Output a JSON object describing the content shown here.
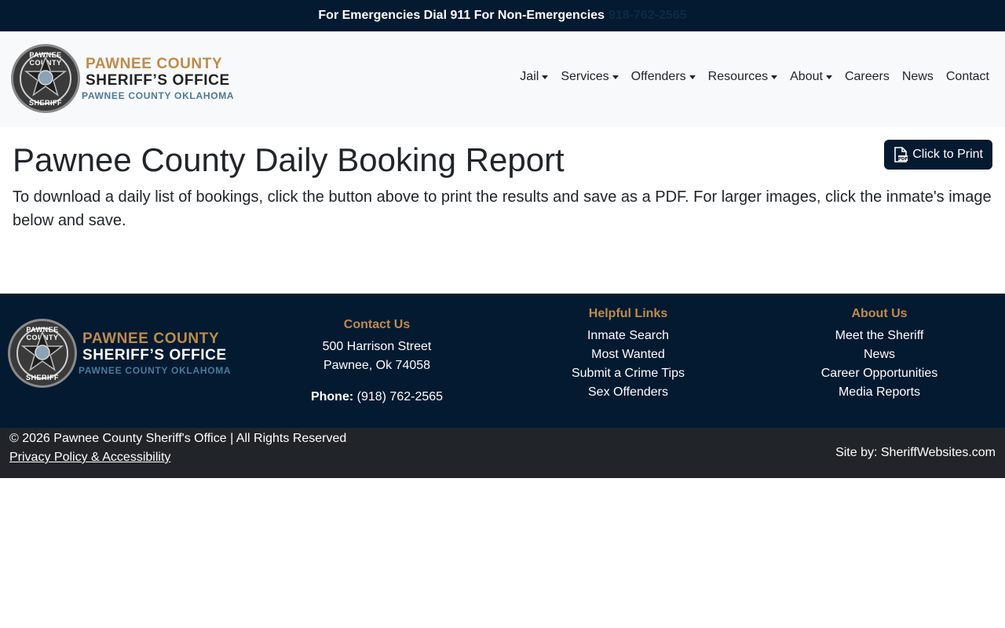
{
  "alert": {
    "text": "For Emergencies Dial 911 For Non-Emergencies",
    "phone": "918-762-2565"
  },
  "logo": {
    "line1": "PAWNEE COUNTY",
    "line2": "SHERIFF’S OFFICE",
    "line3": "PAWNEE COUNTY OKLAHOMA",
    "badge_top": "PAWNEE COUNTY",
    "badge_bottom": "SHERIFF"
  },
  "nav": {
    "items": [
      {
        "label": "Jail",
        "dropdown": true
      },
      {
        "label": "Services",
        "dropdown": true
      },
      {
        "label": "Offenders",
        "dropdown": true
      },
      {
        "label": "Resources",
        "dropdown": true
      },
      {
        "label": "About",
        "dropdown": true
      },
      {
        "label": "Careers",
        "dropdown": false
      },
      {
        "label": "News",
        "dropdown": false
      },
      {
        "label": "Contact",
        "dropdown": false
      }
    ]
  },
  "main": {
    "title": "Pawnee County Daily Booking Report",
    "print_button": "Click to Print",
    "intro": "To download a daily list of bookings, click the button above to print the results and save as a PDF. For larger images, click the inmate's image below and save."
  },
  "footer": {
    "contact": {
      "heading": "Contact Us",
      "address1": "500 Harrison Street",
      "address2": "Pawnee, Ok 74058",
      "phone_label": "Phone:",
      "phone": "(918) 762-2565"
    },
    "helpful_links": {
      "heading": "Helpful Links",
      "items": [
        "Inmate Search",
        "Most Wanted",
        "Submit a Crime Tips",
        "Sex Offenders"
      ]
    },
    "about": {
      "heading": "About Us",
      "items": [
        "Meet the Sheriff",
        "News",
        "Career Opportunities",
        "Media Reports"
      ]
    }
  },
  "bottom": {
    "copyright": "© 2026 Pawnee County Sheriff's Office | All Rights Reserved",
    "privacy": "Privacy Policy & Accessibility",
    "site_by": "Site by: SheriffWebsites.com"
  },
  "colors": {
    "navy": "#031a31",
    "gold": "#c08a4a",
    "steel_blue": "#4d7a9a",
    "dark_bar": "#212529"
  }
}
